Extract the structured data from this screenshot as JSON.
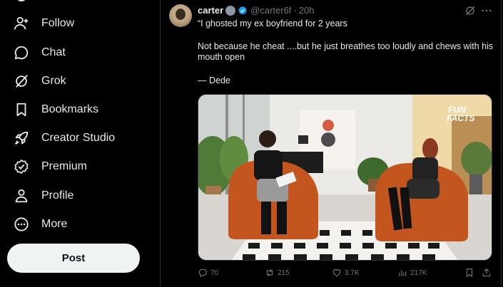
{
  "sidebar": {
    "items": [
      {
        "label": "Follow",
        "icon": "add-person-icon"
      },
      {
        "label": "Chat",
        "icon": "chat-bubble-icon"
      },
      {
        "label": "Grok",
        "icon": "grok-icon"
      },
      {
        "label": "Bookmarks",
        "icon": "bookmark-icon"
      },
      {
        "label": "Creator Studio",
        "icon": "rocket-icon"
      },
      {
        "label": "Premium",
        "icon": "premium-badge-icon"
      },
      {
        "label": "Profile",
        "icon": "person-icon"
      },
      {
        "label": "More",
        "icon": "more-circle-icon"
      }
    ],
    "post_label": "Post"
  },
  "tweet": {
    "name": "carter",
    "handle": "@carter6f",
    "separator": "·",
    "time": "20h",
    "lines": [
      "“I ghosted my ex boyfriend for 2 years",
      "Not because he cheat ....but he just breathes too loudly and chews with his",
      "mouth open",
      "— Dede"
    ],
    "media_overlay": [
      "FUN",
      "FACTS"
    ],
    "actions": {
      "replies": "70",
      "reposts": "215",
      "likes": "3.7K",
      "views": "217K"
    }
  },
  "colors": {
    "background": "#000000",
    "text": "#e7e9ea",
    "muted": "#71767b",
    "verified": "#1d9bf0",
    "post_button": "#eff3f4"
  }
}
